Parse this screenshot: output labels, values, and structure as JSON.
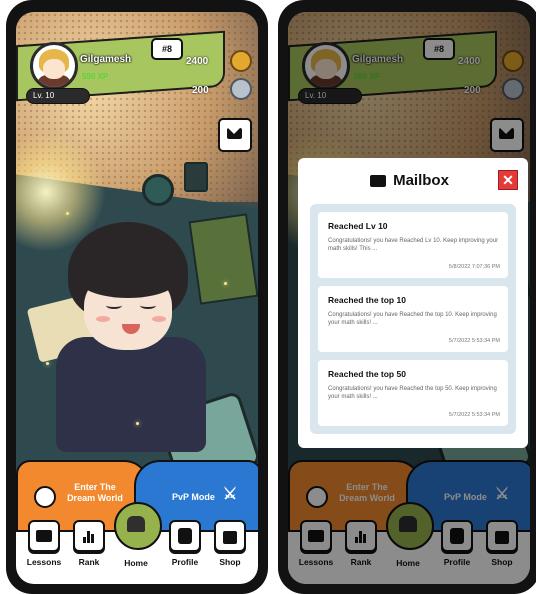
{
  "profile": {
    "username": "Gilgamesh",
    "xp": "550 XP",
    "level": "Lv. 10",
    "rank": "#8",
    "coins": "2400",
    "gems": "200"
  },
  "cards": {
    "dream_world": "Enter The Dream World",
    "pvp": "PvP Mode"
  },
  "nav": {
    "lessons": "Lessons",
    "rank": "Rank",
    "home": "Home",
    "profile": "Profile",
    "shop": "Shop"
  },
  "mailbox": {
    "title": "Mailbox",
    "close": "✕",
    "messages": [
      {
        "title": "Reached Lv 10",
        "body": "Congratulations! you have Reached Lv 10. Keep improving your math skills! This ...",
        "date": "5/8/2022 7:07:36 PM"
      },
      {
        "title": "Reached the top 10",
        "body": "Congratulations! you have Reached the top 10. Keep improving your math skills! ...",
        "date": "5/7/2022 5:53:34 PM"
      },
      {
        "title": "Reached the top 50",
        "body": "Congratulations! you have Reached the top 50. Keep improving your math skills! ...",
        "date": "5/7/2022 5:53:34 PM"
      }
    ]
  },
  "colors": {
    "header_green": "#a8c660",
    "dream_orange": "#f2892f",
    "pvp_blue": "#2a78d1",
    "close_red": "#e53a3a"
  }
}
